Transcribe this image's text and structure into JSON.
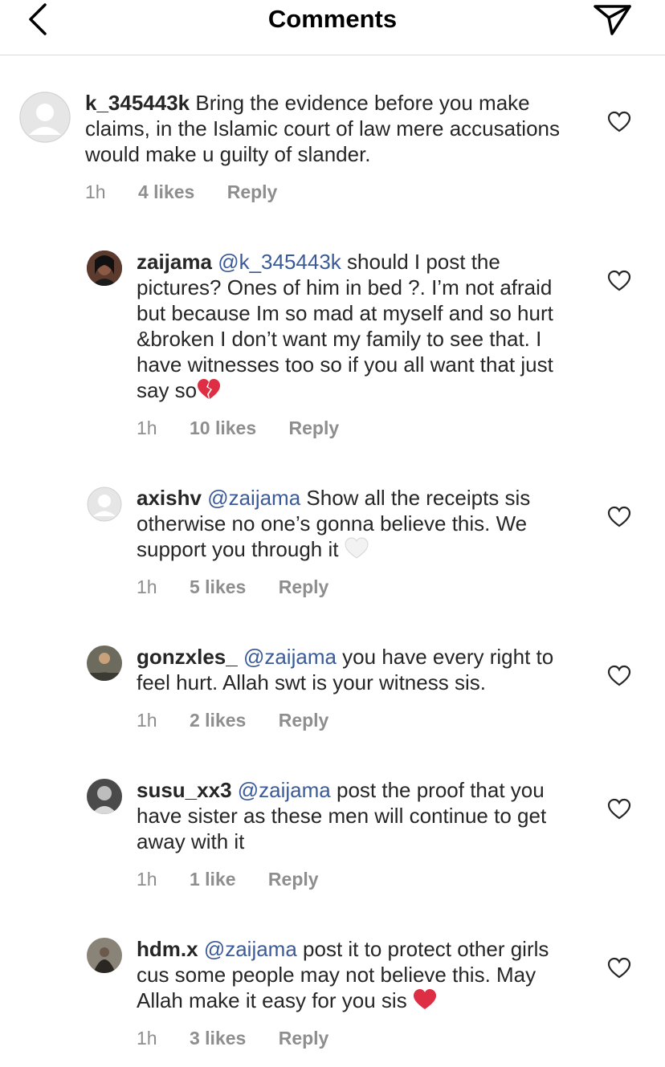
{
  "header": {
    "title": "Comments"
  },
  "comments": [
    {
      "user": "k_345443k",
      "mention": "",
      "text": "Bring the evidence before you make claims, in the Islamic court of law mere accusations would make u guilty of slander.",
      "time": "1h",
      "likes": "4 likes",
      "reply": "Reply",
      "emoji": ""
    },
    {
      "user": "zaijama",
      "mention": "@k_345443k",
      "text": "should I post the pictures? Ones of him in bed ?. I’m not afraid but because Im so mad at myself and so hurt &broken I don’t want my family to see that. I have witnesses too so if you all want that just say so",
      "time": "1h",
      "likes": "10 likes",
      "reply": "Reply",
      "emoji": "broken-heart"
    },
    {
      "user": "axishv",
      "mention": "@zaijama",
      "text": "Show all the receipts sis otherwise no one’s gonna believe this. We support you through it",
      "time": "1h",
      "likes": "5 likes",
      "reply": "Reply",
      "emoji": "white-heart"
    },
    {
      "user": "gonzxles_",
      "mention": "@zaijama",
      "text": "you have every right to feel hurt. Allah swt is your witness sis.",
      "time": "1h",
      "likes": "2 likes",
      "reply": "Reply",
      "emoji": ""
    },
    {
      "user": "susu_xx3",
      "mention": "@zaijama",
      "text": "post the proof that you have sister as these men will continue to get away with it",
      "time": "1h",
      "likes": "1 like",
      "reply": "Reply",
      "emoji": ""
    },
    {
      "user": "hdm.x",
      "mention": "@zaijama",
      "text": "post it to protect other girls cus some people may not believe this. May Allah make it easy for you sis",
      "time": "1h",
      "likes": "3 likes",
      "reply": "Reply",
      "emoji": "red-heart"
    }
  ],
  "colors": {
    "accent_link": "#3a5a98",
    "meta_gray": "#8e8e8e",
    "text": "#262626"
  }
}
